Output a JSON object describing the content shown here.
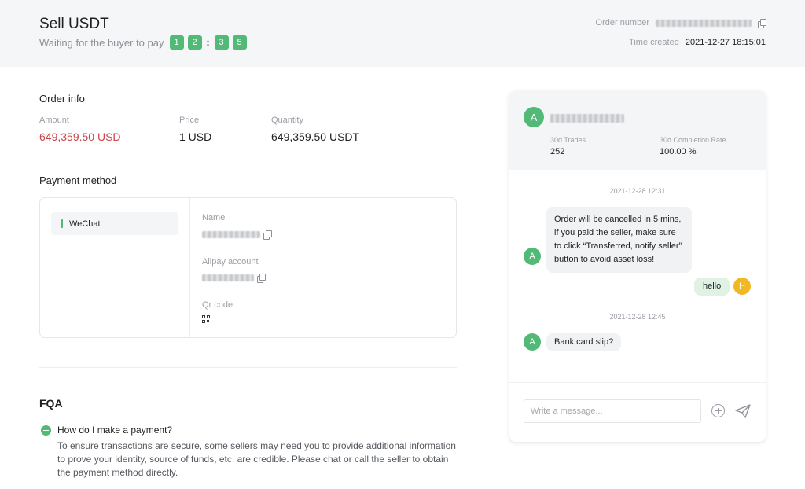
{
  "header": {
    "title": "Sell USDT",
    "status_text": "Waiting for the buyer to pay",
    "countdown_digits": [
      "1",
      "2",
      "3",
      "5"
    ],
    "countdown_separator": ":",
    "order_number_label": "Order number",
    "time_created_label": "Time created",
    "time_created_value": "2021-12-27 18:15:01"
  },
  "order_info": {
    "section_title": "Order info",
    "amount_label": "Amount",
    "amount_value": "649,359.50 USD",
    "price_label": "Price",
    "price_value": "1 USD",
    "quantity_label": "Quantity",
    "quantity_value": "649,359.50 USDT"
  },
  "payment": {
    "section_title": "Payment method",
    "method_tab": "WeChat",
    "name_label": "Name",
    "account_label": "Alipay account",
    "qr_label": "Qr code"
  },
  "faq": {
    "section_title": "FQA",
    "question": "How do I make a payment?",
    "answer": "To ensure transactions are secure, some sellers may need you to provide additional information to prove your identity, source of funds, etc. are credible. Please chat or call the seller to obtain the payment method directly."
  },
  "chat": {
    "counterparty_initial": "A",
    "trades_label": "30d Trades",
    "trades_value": "252",
    "completion_label": "30d Completion Rate",
    "completion_value": "100.00 %",
    "time_1": "2021-12-28 12:31",
    "message_1": "Order will be cancelled in 5 mins, if you paid the seller, make sure to click “Transferred, notify seller” button to avoid asset loss!",
    "message_1_sender_initial": "A",
    "message_2": "hello",
    "message_2_sender_initial": "H",
    "time_2": "2021-12-28 12:45",
    "message_3": "Bank card slip?",
    "message_3_sender_initial": "A",
    "input_placeholder": "Write a message..."
  },
  "colors": {
    "accent_green": "#52b976",
    "amount_red": "#c9454a",
    "user_avatar_orange": "#f2b822"
  },
  "icons": [
    "copy-icon",
    "qr-code-icon",
    "minus-circle-icon",
    "plus-circle-icon",
    "send-icon"
  ]
}
